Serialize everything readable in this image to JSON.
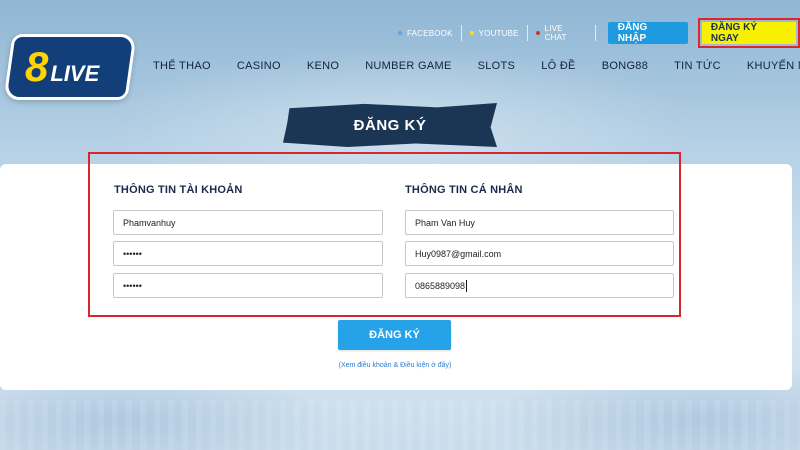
{
  "topbar": {
    "links": [
      {
        "label": "FACEBOOK",
        "dot_color": "#5aa6e8"
      },
      {
        "label": "YOUTUBE",
        "dot_color": "#f3e21a"
      },
      {
        "label": "LIVE CHAT",
        "dot_color": "#c0392b"
      }
    ],
    "login_label": "ĐĂNG NHẬP",
    "register_now_label": "ĐĂNG KÝ NGAY"
  },
  "logo": {
    "number": "8",
    "word": "LIVE"
  },
  "nav": {
    "items": [
      "THỂ THAO",
      "CASINO",
      "KENO",
      "NUMBER GAME",
      "SLOTS",
      "LÔ ĐỀ",
      "BONG88",
      "TIN TỨC",
      "KHUYẾN MÃI"
    ]
  },
  "page_title": "ĐĂNG KÝ",
  "form": {
    "account_title": "THÔNG TIN TÀI KHOẢN",
    "personal_title": "THÔNG TIN CÁ NHÂN",
    "username_value": "Phamvanhuy",
    "password_value": "••••••",
    "confirm_password_value": "••••••",
    "fullname_value": "Pham Van Huy",
    "email_value": "Huy0987@gmail.com",
    "phone_value": "0865889098",
    "submit_label": "ĐĂNG KÝ",
    "terms_text": "(Xem điều khoản & Điều kiện ở đây)"
  },
  "colors": {
    "accent_blue": "#26a3e8",
    "highlight_red": "#d8262e",
    "cta_yellow": "#f7f000",
    "logo_navy": "#123f7a"
  }
}
